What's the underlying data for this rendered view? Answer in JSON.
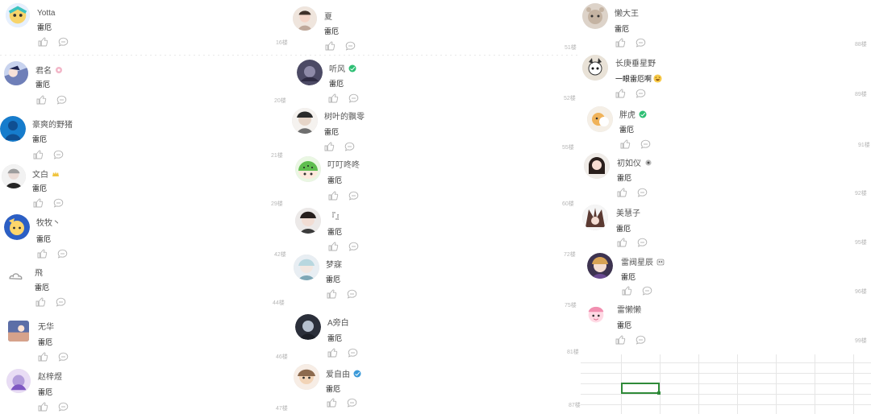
{
  "comments": {
    "c1": {
      "username": "Yotta",
      "text": "雷厄",
      "floor": "16楼"
    },
    "c2": {
      "username": "君名",
      "text": "雷厄",
      "floor": "20楼"
    },
    "c3": {
      "username": "豪爽的野猪",
      "text": "雷厄",
      "floor": "21楼"
    },
    "c4": {
      "username": "文白",
      "text": "雷厄",
      "floor": "29楼"
    },
    "c5": {
      "username": "牧牧丶",
      "text": "雷厄",
      "floor": "42楼"
    },
    "c6": {
      "username": "飛",
      "text": "雷厄",
      "floor": "44楼"
    },
    "c7": {
      "username": "无华",
      "text": "雷厄",
      "floor": "46楼"
    },
    "c8": {
      "username": "赵梓煜",
      "text": "雷厄",
      "floor": "47楼"
    },
    "c9": {
      "username": "夏",
      "text": "雷厄",
      "floor": "51楼"
    },
    "c10": {
      "username": "听风",
      "text": "雷厄",
      "floor": "52楼"
    },
    "c11": {
      "username": "树叶的飘零",
      "text": "雷厄",
      "floor": "55楼"
    },
    "c12": {
      "username": "叮叮咚咚",
      "text": "雷厄",
      "floor": "60楼"
    },
    "c13": {
      "username": "『』",
      "text": "雷厄",
      "floor": "72楼"
    },
    "c14": {
      "username": "梦寐",
      "text": "雷厄",
      "floor": "75楼"
    },
    "c15": {
      "username": "A旁白",
      "text": "雷厄",
      "floor": "81楼"
    },
    "c16": {
      "username": "爱自由",
      "text": "雷厄",
      "floor": "87楼"
    },
    "c17": {
      "username": "懒大王",
      "text": "雷厄",
      "floor": "88楼"
    },
    "c18": {
      "username": "长庚垂星野",
      "text": "一眼雷厄啊",
      "floor": "89楼"
    },
    "c19": {
      "username": "胖虎",
      "text": "雷厄",
      "floor": "91楼"
    },
    "c20": {
      "username": "初如仪",
      "text": "雷厄",
      "floor": "92楼"
    },
    "c21": {
      "username": "美慧子",
      "text": "雷厄",
      "floor": "95楼"
    },
    "c22": {
      "username": "雷阀星辰",
      "text": "雷厄",
      "floor": "96楼"
    },
    "c23": {
      "username": "雷懒懒",
      "text": "雷厄",
      "floor": "99楼"
    }
  },
  "icons": {
    "like": "thumbs-up-icon",
    "reply": "comment-bubble-icon"
  },
  "colors": {
    "username": "#555555",
    "content": "#111111",
    "floor": "#b7b7b7",
    "icon": "#b3b3b3",
    "sheetSelection": "#2f8a39"
  }
}
